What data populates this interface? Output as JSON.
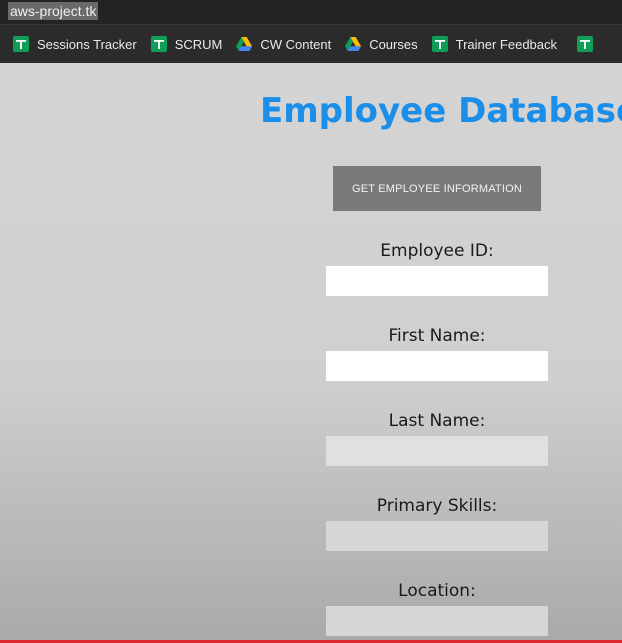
{
  "browser": {
    "url": "aws-project.tk"
  },
  "bookmarks": [
    {
      "label": "Sessions Tracker",
      "icon": "google-sheets-icon"
    },
    {
      "label": "SCRUM",
      "icon": "google-sheets-icon"
    },
    {
      "label": "CW Content",
      "icon": "google-drive-icon"
    },
    {
      "label": "Courses",
      "icon": "google-drive-icon"
    },
    {
      "label": "Trainer Feedback",
      "icon": "google-sheets-icon"
    },
    {
      "label": "",
      "icon": "google-sheets-icon"
    }
  ],
  "page": {
    "title": "Employee Database",
    "get_button_label": "GET EMPLOYEE INFORMATION",
    "fields": [
      {
        "label": "Employee ID:",
        "value": "",
        "enabled": true
      },
      {
        "label": "First Name:",
        "value": "",
        "enabled": true
      },
      {
        "label": "Last Name:",
        "value": "",
        "enabled": false
      },
      {
        "label": "Primary Skills:",
        "value": "",
        "enabled": false
      },
      {
        "label": "Location:",
        "value": "",
        "enabled": false
      }
    ]
  },
  "colors": {
    "title": "#1a8ee8",
    "button_bg": "#7a7a7a",
    "accent_line": "#e0282f",
    "sheets_green": "#0f9d58"
  }
}
